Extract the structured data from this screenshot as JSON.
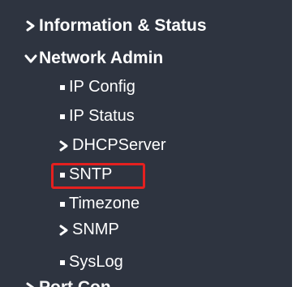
{
  "menu": {
    "items": [
      {
        "label": "Information & Status",
        "icon": "chevron-right-icon",
        "expanded": false
      },
      {
        "label": "Network Admin",
        "icon": "chevron-down-icon",
        "expanded": true,
        "children": [
          {
            "label": "IP Config",
            "icon": "bullet-icon"
          },
          {
            "label": "IP Status",
            "icon": "bullet-icon"
          },
          {
            "label": "DHCPServer",
            "icon": "chevron-right-icon"
          },
          {
            "label": "SNTP",
            "icon": "bullet-icon",
            "highlighted": true
          },
          {
            "label": "Timezone",
            "icon": "bullet-icon"
          },
          {
            "label": "SNMP",
            "icon": "chevron-right-icon"
          },
          {
            "label": "SysLog",
            "icon": "bullet-icon"
          }
        ]
      },
      {
        "label": "Port Con...",
        "icon": "chevron-right-icon",
        "partially_visible": true
      }
    ]
  },
  "colors": {
    "background": "#2e3440",
    "text": "#ffffff",
    "highlight_border": "#e5201f"
  }
}
